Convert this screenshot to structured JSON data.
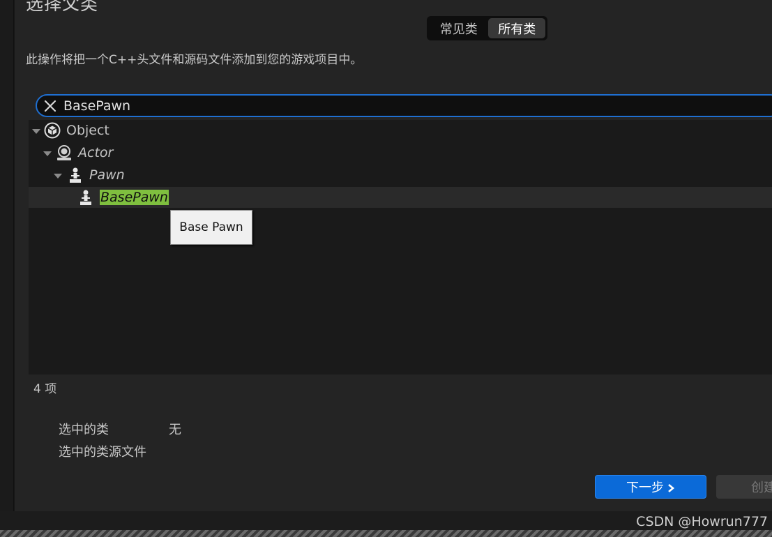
{
  "dialog": {
    "title": "选择父类",
    "description": "此操作将把一个C++头文件和源码文件添加到您的游戏项目中。"
  },
  "tabs": {
    "common": "常见类",
    "all": "所有类",
    "selected": "all"
  },
  "search": {
    "value": "BasePawn"
  },
  "tree": {
    "items": [
      {
        "label": "Object",
        "icon": "object-cube-icon",
        "expanded": true
      },
      {
        "label": "Actor",
        "icon": "actor-icon",
        "expanded": true
      },
      {
        "label": "Pawn",
        "icon": "pawn-icon",
        "expanded": true
      },
      {
        "label": "BasePawn",
        "icon": "pawn-icon",
        "selected": true,
        "match_highlight": "#7fbf3f"
      }
    ],
    "tooltip": "Base Pawn"
  },
  "count_label": "4 项",
  "selection": {
    "class_label": "选中的类",
    "class_value": "无",
    "source_label": "选中的类源文件"
  },
  "footer": {
    "next_label": "下一步",
    "create_label": "创建"
  },
  "watermark": "CSDN @Howrun777",
  "colors": {
    "accent": "#0b6ad8",
    "search_border": "#1f6fd1",
    "match_highlight": "#7fbf3f"
  }
}
